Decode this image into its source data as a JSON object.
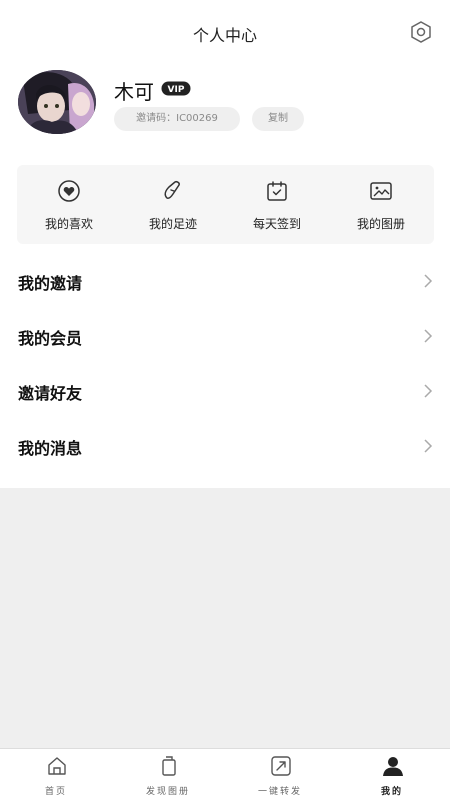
{
  "header": {
    "title": "个人中心",
    "settings_icon": "settings-hexagon-icon"
  },
  "profile": {
    "name": "木可",
    "vip_label": "VIP",
    "invite_code": "邀请码：IC00269",
    "copy_label": "复制"
  },
  "quick_actions": [
    {
      "label": "我的喜欢",
      "icon": "heart-icon"
    },
    {
      "label": "我的足迹",
      "icon": "footprint-icon"
    },
    {
      "label": "每天签到",
      "icon": "calendar-check-icon"
    },
    {
      "label": "我的图册",
      "icon": "album-icon"
    }
  ],
  "menu": [
    {
      "label": "我的邀请"
    },
    {
      "label": "我的会员"
    },
    {
      "label": "邀请好友"
    },
    {
      "label": "我的消息"
    }
  ],
  "tabbar": {
    "items": [
      {
        "label": "首页",
        "icon": "home-icon"
      },
      {
        "label": "发现图册",
        "icon": "album-stack-icon"
      },
      {
        "label": "一键转发",
        "icon": "share-icon"
      },
      {
        "label": "我的",
        "icon": "user-icon",
        "active": true
      }
    ],
    "active_color": "#222222",
    "inactive_color": "#666666"
  }
}
